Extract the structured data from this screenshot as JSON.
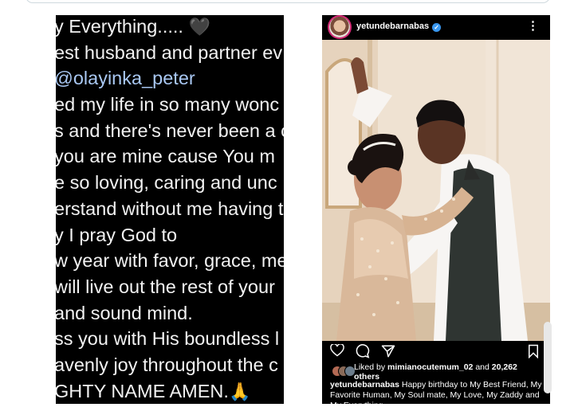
{
  "left_text": {
    "lines": [
      "y Everything.....",
      "est husband and partner ev",
      "@olayinka_peter",
      "ed my life in so many wonc",
      "s and there's never been a c",
      "you are mine cause You m",
      "e so loving, caring and unc",
      "erstand without me having t",
      "y I pray God to",
      "w year with favor, grace, me",
      "will live out the rest of your",
      "and sound mind.",
      "ss you with His boundless l",
      "avenly joy throughout the c",
      "GHTY NAME AMEN."
    ],
    "heart_glyph": "🖤",
    "pray_glyph": "🙏"
  },
  "instagram": {
    "username": "yetundebarnabas",
    "verified_mark": "✓",
    "more_glyph": "⋮",
    "liked_prefix": "Liked by ",
    "liked_user": "mimianocutemum_02",
    "liked_suffix": " and ",
    "liked_count": "20,262",
    "liked_others": "others",
    "caption_user": "yetundebarnabas",
    "caption_text": " Happy birthday to My Best Friend, My Favorite Human, My Soul mate, My Love, My Zaddy and My Everything......"
  },
  "colors": {
    "mention": "#a9c8f3",
    "verified": "#3897f0",
    "story_ring": "#d62976"
  }
}
